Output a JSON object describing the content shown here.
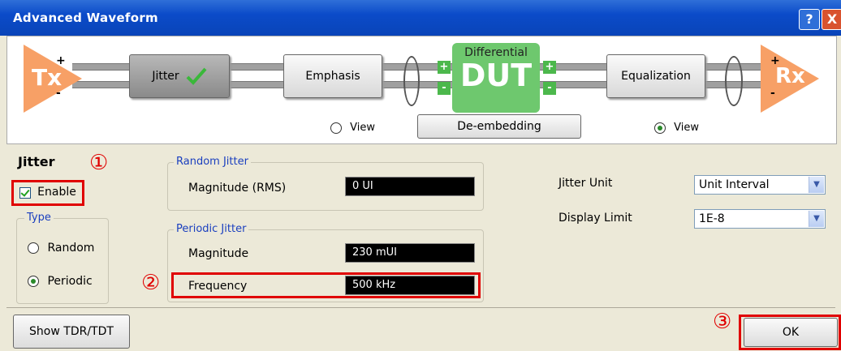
{
  "window": {
    "title": "Advanced Waveform",
    "help": "?",
    "close": "X"
  },
  "diagram": {
    "tx_label": "Tx",
    "rx_label": "Rx",
    "plus": "+",
    "minus": "-",
    "jitter_block": "Jitter",
    "emphasis_block": "Emphasis",
    "dut_sub": "Differential",
    "dut_main": "DUT",
    "equalization_block": "Equalization",
    "view_left": "View",
    "view_right": "View",
    "deembedding_button": "De-embedding"
  },
  "jitter_panel": {
    "heading": "Jitter",
    "enable_label": "Enable",
    "enable_checked": true,
    "type_legend": "Type",
    "type_options": [
      "Random",
      "Periodic"
    ],
    "type_selected": "Periodic"
  },
  "random_jitter": {
    "legend": "Random Jitter",
    "magnitude_label": "Magnitude (RMS)",
    "magnitude_value": "0 UI"
  },
  "periodic_jitter": {
    "legend": "Periodic Jitter",
    "magnitude_label": "Magnitude",
    "magnitude_value": "230 mUI",
    "frequency_label": "Frequency",
    "frequency_value": "500 kHz"
  },
  "settings": {
    "jitter_unit_label": "Jitter Unit",
    "jitter_unit_value": "Unit Interval",
    "display_limit_label": "Display Limit",
    "display_limit_value": "1E-8"
  },
  "footer": {
    "show_tdr_button": "Show TDR/TDT",
    "ok_button": "OK"
  },
  "annotations": {
    "one": "①",
    "two": "②",
    "three": "③",
    "color": "#e00000"
  },
  "colors": {
    "tx_rx": "#f7a066",
    "dut": "#6ec86e",
    "titlebar": "#0b4bc9"
  }
}
